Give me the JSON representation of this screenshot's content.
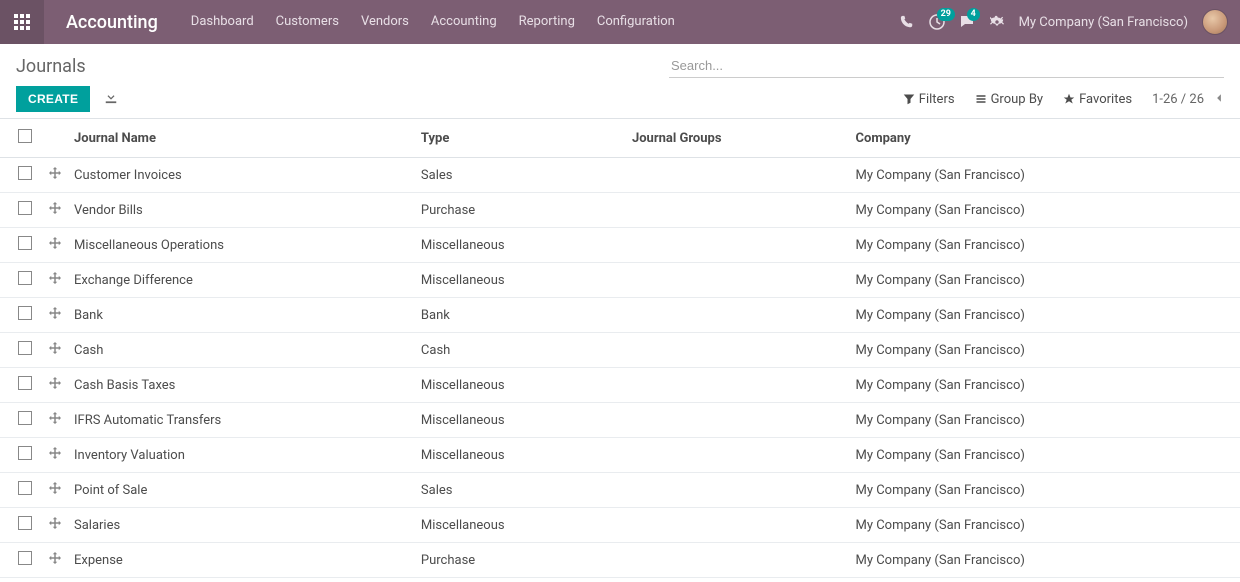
{
  "navbar": {
    "app_title": "Accounting",
    "menu": [
      "Dashboard",
      "Customers",
      "Vendors",
      "Accounting",
      "Reporting",
      "Configuration"
    ],
    "activities_badge": "29",
    "messages_badge": "4",
    "company": "My Company (San Francisco)"
  },
  "control_panel": {
    "breadcrumb": "Journals",
    "search_placeholder": "Search...",
    "create_label": "CREATE",
    "filters_label": "Filters",
    "groupby_label": "Group By",
    "favorites_label": "Favorites",
    "pager": "1-26 / 26"
  },
  "table": {
    "columns": {
      "name": "Journal Name",
      "type": "Type",
      "groups": "Journal Groups",
      "company": "Company"
    },
    "rows": [
      {
        "name": "Customer Invoices",
        "type": "Sales",
        "groups": "",
        "company": "My Company (San Francisco)"
      },
      {
        "name": "Vendor Bills",
        "type": "Purchase",
        "groups": "",
        "company": "My Company (San Francisco)"
      },
      {
        "name": "Miscellaneous Operations",
        "type": "Miscellaneous",
        "groups": "",
        "company": "My Company (San Francisco)"
      },
      {
        "name": "Exchange Difference",
        "type": "Miscellaneous",
        "groups": "",
        "company": "My Company (San Francisco)"
      },
      {
        "name": "Bank",
        "type": "Bank",
        "groups": "",
        "company": "My Company (San Francisco)"
      },
      {
        "name": "Cash",
        "type": "Cash",
        "groups": "",
        "company": "My Company (San Francisco)"
      },
      {
        "name": "Cash Basis Taxes",
        "type": "Miscellaneous",
        "groups": "",
        "company": "My Company (San Francisco)"
      },
      {
        "name": "IFRS Automatic Transfers",
        "type": "Miscellaneous",
        "groups": "",
        "company": "My Company (San Francisco)"
      },
      {
        "name": "Inventory Valuation",
        "type": "Miscellaneous",
        "groups": "",
        "company": "My Company (San Francisco)"
      },
      {
        "name": "Point of Sale",
        "type": "Sales",
        "groups": "",
        "company": "My Company (San Francisco)"
      },
      {
        "name": "Salaries",
        "type": "Miscellaneous",
        "groups": "",
        "company": "My Company (San Francisco)"
      },
      {
        "name": "Expense",
        "type": "Purchase",
        "groups": "",
        "company": "My Company (San Francisco)"
      }
    ]
  }
}
